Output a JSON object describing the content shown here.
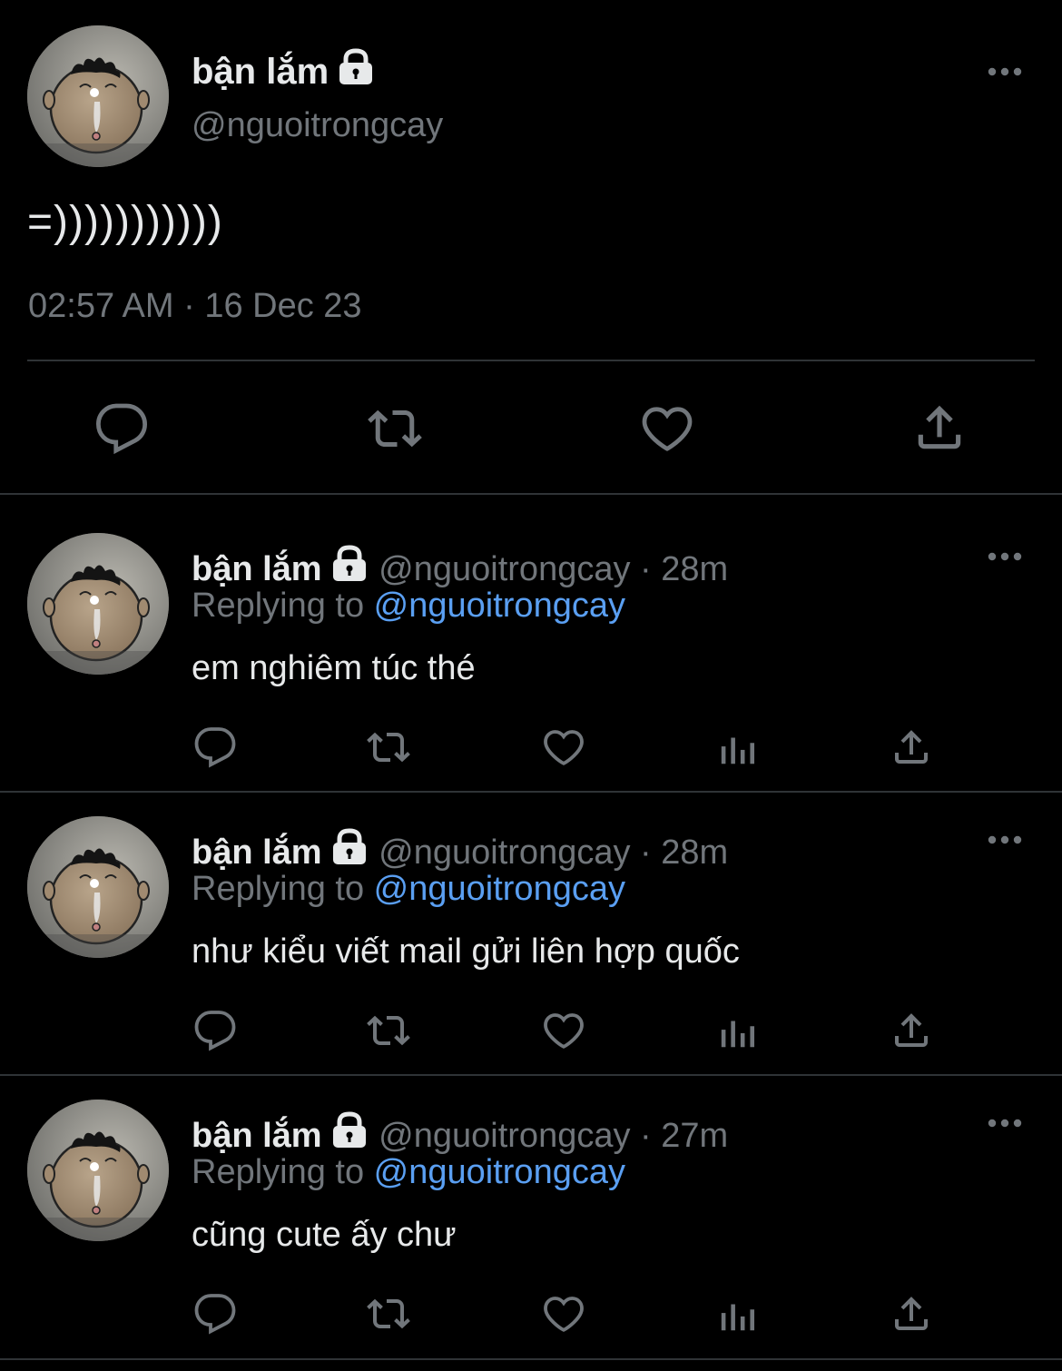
{
  "main_tweet": {
    "display_name": "bận lắm",
    "handle": "@nguoitrongcay",
    "text": "=)))))))))))",
    "timestamp": "02:57 AM · 16 Dec 23"
  },
  "replies": [
    {
      "display_name": "bận lắm",
      "handle_time": "@nguoitrongcay · 28m",
      "replying_prefix": "Replying to ",
      "replying_to": "@nguoitrongcay",
      "text": "em nghiêm túc thé"
    },
    {
      "display_name": "bận lắm",
      "handle_time": "@nguoitrongcay · 28m",
      "replying_prefix": "Replying to ",
      "replying_to": "@nguoitrongcay",
      "text": "như kiểu viết mail gửi liên hợp quốc"
    },
    {
      "display_name": "bận lắm",
      "handle_time": "@nguoitrongcay · 27m",
      "replying_prefix": "Replying to ",
      "replying_to": "@nguoitrongcay",
      "text": "cũng cute ấy chư"
    }
  ],
  "colors": {
    "background": "#000000",
    "text": "#e7e9ea",
    "secondary": "#71767b",
    "link": "#5a9ff2",
    "divider": "#2f3336"
  },
  "icons": [
    "lock-icon",
    "more-icon",
    "reply-icon",
    "retweet-icon",
    "like-icon",
    "views-icon",
    "share-icon"
  ]
}
